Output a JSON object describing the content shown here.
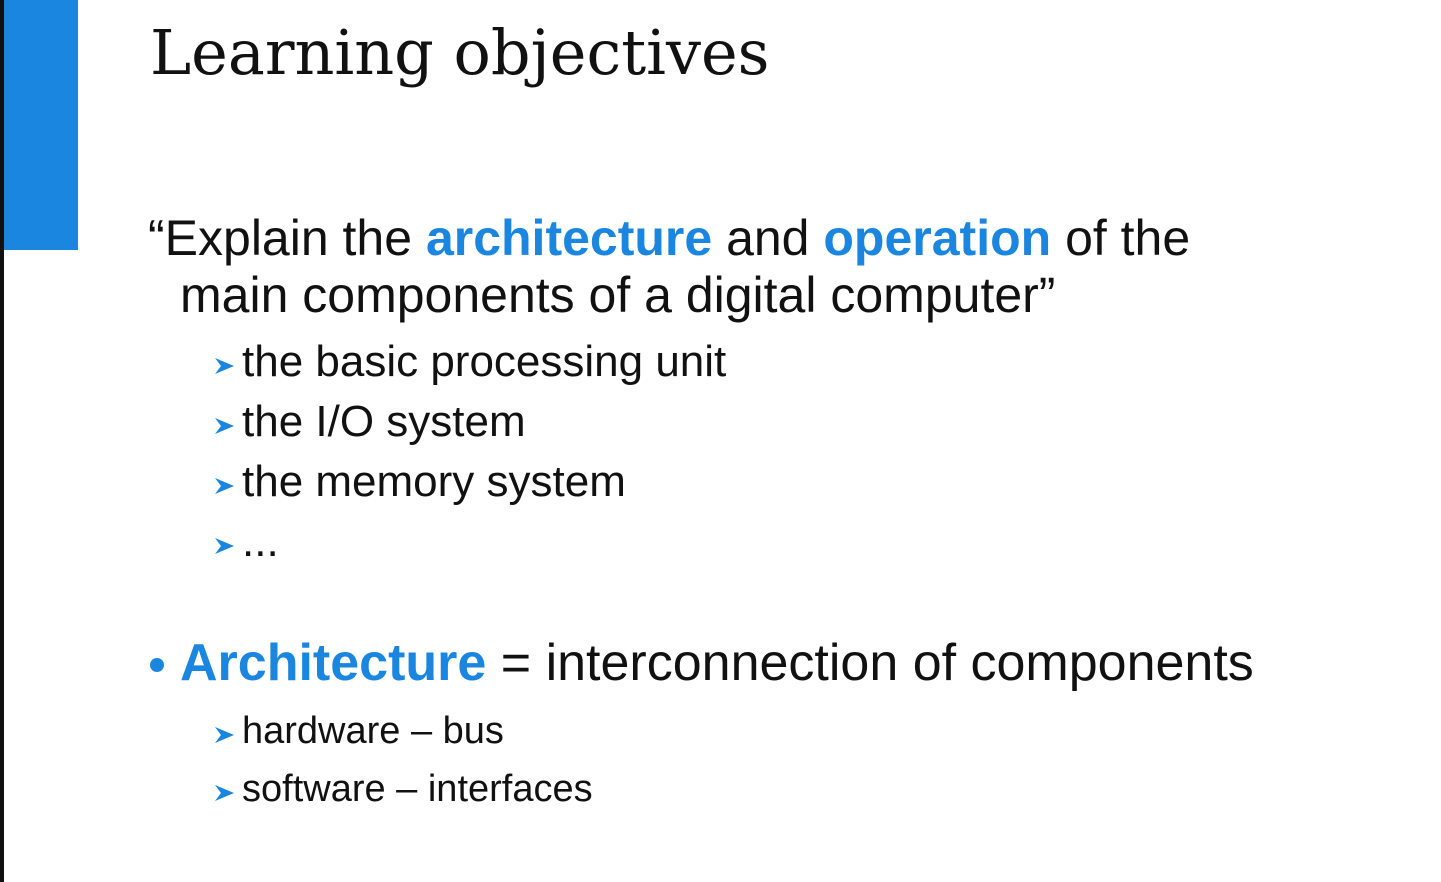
{
  "slide": {
    "title": "Learning objectives",
    "accent_color": "#1a86e0",
    "quote": {
      "open_mark": "“",
      "text_1": "Explain the ",
      "highlight_1": "architecture",
      "text_2": " and ",
      "highlight_2": "operation",
      "text_3": " of the",
      "line2": "main components of a digital computer”"
    },
    "sub_items": [
      {
        "label": "the basic processing unit",
        "icon": "arrow-bullet-icon"
      },
      {
        "label": "the I/O system",
        "icon": "arrow-bullet-icon"
      },
      {
        "label": "the memory system",
        "icon": "arrow-bullet-icon"
      },
      {
        "label": "...",
        "icon": "arrow-bullet-icon"
      }
    ],
    "bullet": {
      "icon": "dot-bullet-icon",
      "term": "Architecture",
      "definition": " = interconnection of components"
    },
    "bullet_sub_items": [
      {
        "label": "hardware – bus",
        "icon": "arrow-bullet-icon"
      },
      {
        "label": "software – interfaces",
        "icon": "arrow-bullet-icon"
      }
    ]
  }
}
